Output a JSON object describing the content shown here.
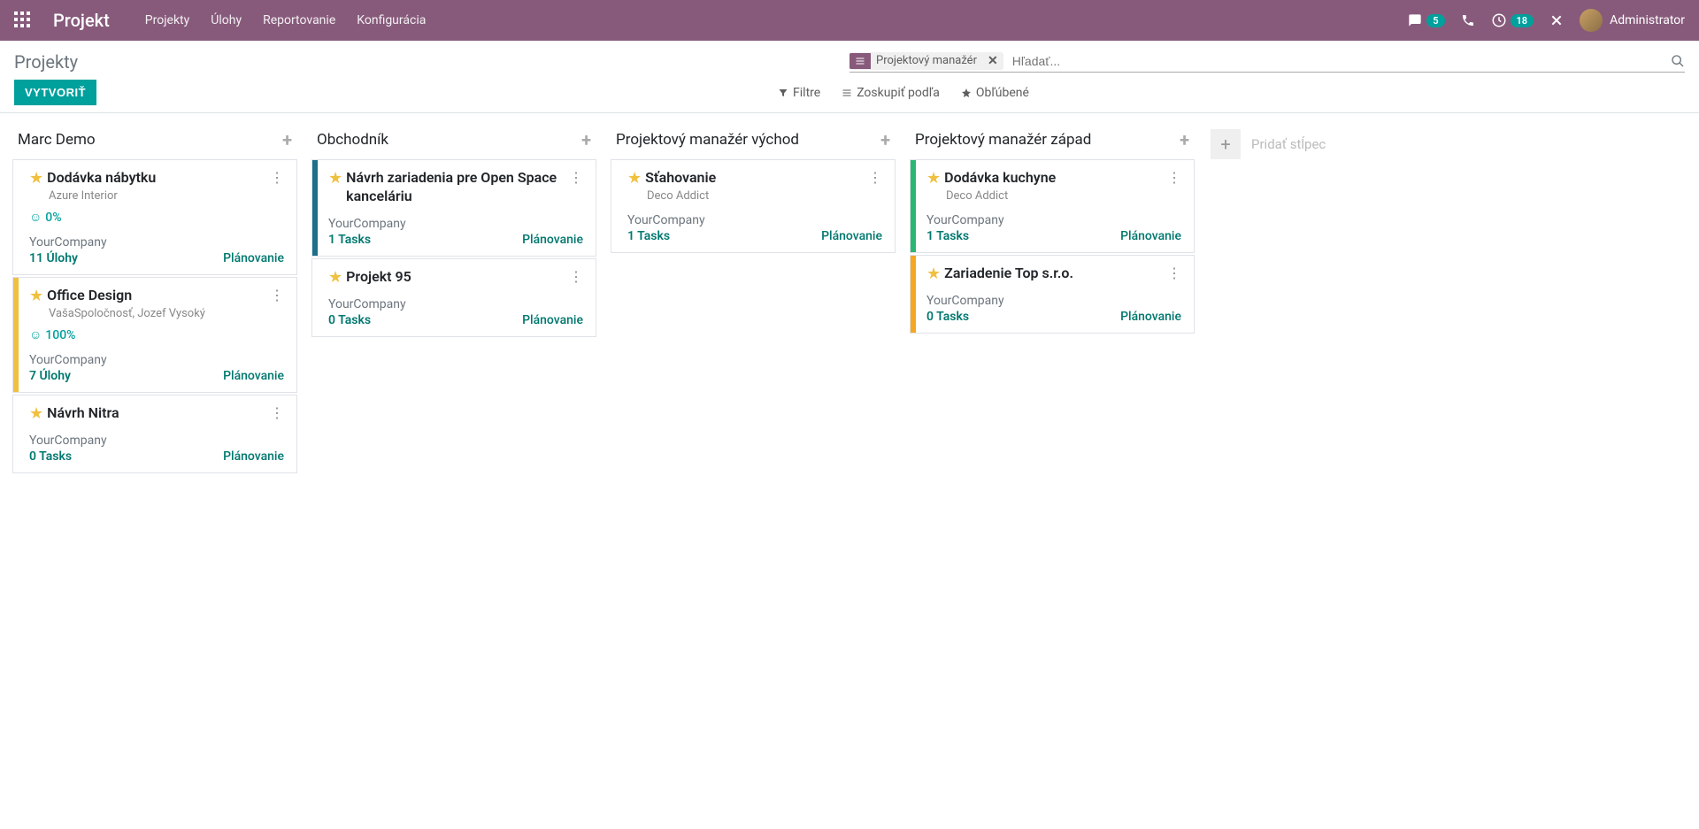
{
  "topbar": {
    "brand": "Projekt",
    "menu": [
      "Projekty",
      "Úlohy",
      "Reportovanie",
      "Konfigurácia"
    ],
    "messages_badge": "5",
    "activities_badge": "18",
    "user": "Administrator"
  },
  "page": {
    "title": "Projekty",
    "create_button": "VYTVORIŤ",
    "search": {
      "facet_label": "Projektový manažér",
      "placeholder": "Hľadať..."
    },
    "filters_label": "Filtre",
    "groupby_label": "Zoskupiť podľa",
    "favorites_label": "Obľúbené",
    "add_column_label": "Pridať stĺpec"
  },
  "columns": [
    {
      "title": "Marc Demo",
      "cards": [
        {
          "title": "Dodávka nábytku",
          "subtitle": "Azure Interior",
          "happy": "0%",
          "company": "YourCompany",
          "tasks": "11 Úlohy",
          "plan": "Plánovanie",
          "stripe": ""
        },
        {
          "title": "Office Design",
          "subtitle": "VašaSpoločnosť, Jozef Vysoký",
          "happy": "100%",
          "company": "YourCompany",
          "tasks": "7 Úlohy",
          "plan": "Plánovanie",
          "stripe": "#f0c040"
        },
        {
          "title": "Návrh Nitra",
          "subtitle": "",
          "happy": "",
          "company": "YourCompany",
          "tasks": "0 Tasks",
          "plan": "Plánovanie",
          "stripe": ""
        }
      ]
    },
    {
      "title": "Obchodník",
      "cards": [
        {
          "title": "Návrh zariadenia pre Open Space kanceláriu",
          "subtitle": "",
          "happy": "",
          "company": "YourCompany",
          "tasks": "1 Tasks",
          "plan": "Plánovanie",
          "stripe": "#1d6f8b"
        },
        {
          "title": "Projekt 95",
          "subtitle": "",
          "happy": "",
          "company": "YourCompany",
          "tasks": "0 Tasks",
          "plan": "Plánovanie",
          "stripe": ""
        }
      ]
    },
    {
      "title": "Projektový manažér východ",
      "cards": [
        {
          "title": "Sťahovanie",
          "subtitle": "Deco Addict",
          "happy": "",
          "company": "YourCompany",
          "tasks": "1 Tasks",
          "plan": "Plánovanie",
          "stripe": ""
        }
      ]
    },
    {
      "title": "Projektový manažér západ",
      "cards": [
        {
          "title": "Dodávka kuchyne",
          "subtitle": "Deco Addict",
          "happy": "",
          "company": "YourCompany",
          "tasks": "1 Tasks",
          "plan": "Plánovanie",
          "stripe": "#2bb673"
        },
        {
          "title": "Zariadenie Top s.r.o.",
          "subtitle": "",
          "happy": "",
          "company": "YourCompany",
          "tasks": "0 Tasks",
          "plan": "Plánovanie",
          "stripe": "#f5a623"
        }
      ]
    }
  ]
}
